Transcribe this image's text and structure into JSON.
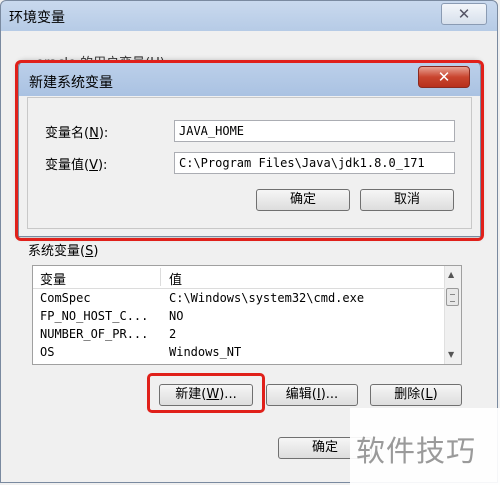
{
  "outer_window": {
    "title": "环境变量",
    "close_icon": "close-icon",
    "user_vars_label": "oracle 的用户变量(U)",
    "system_vars_label": "系统变量(S)",
    "system_vars_label_pre": "系统变量(",
    "system_vars_label_key": "S",
    "system_vars_label_post": ")",
    "columns": [
      "变量",
      "值"
    ],
    "rows": [
      {
        "name": "ComSpec",
        "value": "C:\\Windows\\system32\\cmd.exe"
      },
      {
        "name": "FP_NO_HOST_C...",
        "value": "NO"
      },
      {
        "name": "NUMBER_OF_PR...",
        "value": "2"
      },
      {
        "name": "OS",
        "value": "Windows_NT"
      }
    ],
    "buttons": {
      "new_pre": "新建(",
      "new_key": "W",
      "new_post": ")...",
      "edit_pre": "编辑(",
      "edit_key": "I",
      "edit_post": ")...",
      "delete_pre": "删除(",
      "delete_key": "L",
      "delete_post": ")",
      "ok": "确定"
    }
  },
  "new_dialog": {
    "title": "新建系统变量",
    "name_label_pre": "变量名(",
    "name_label_key": "N",
    "name_label_post": "):",
    "value_label_pre": "变量值(",
    "value_label_key": "V",
    "value_label_post": "):",
    "name_value": "JAVA_HOME",
    "value_value": "C:\\Program Files\\Java\\jdk1.8.0_171",
    "ok": "确定",
    "cancel": "取消"
  },
  "watermark": "软件技巧",
  "colors": {
    "highlight": "#e0201a",
    "close_button": "#c9452f"
  }
}
